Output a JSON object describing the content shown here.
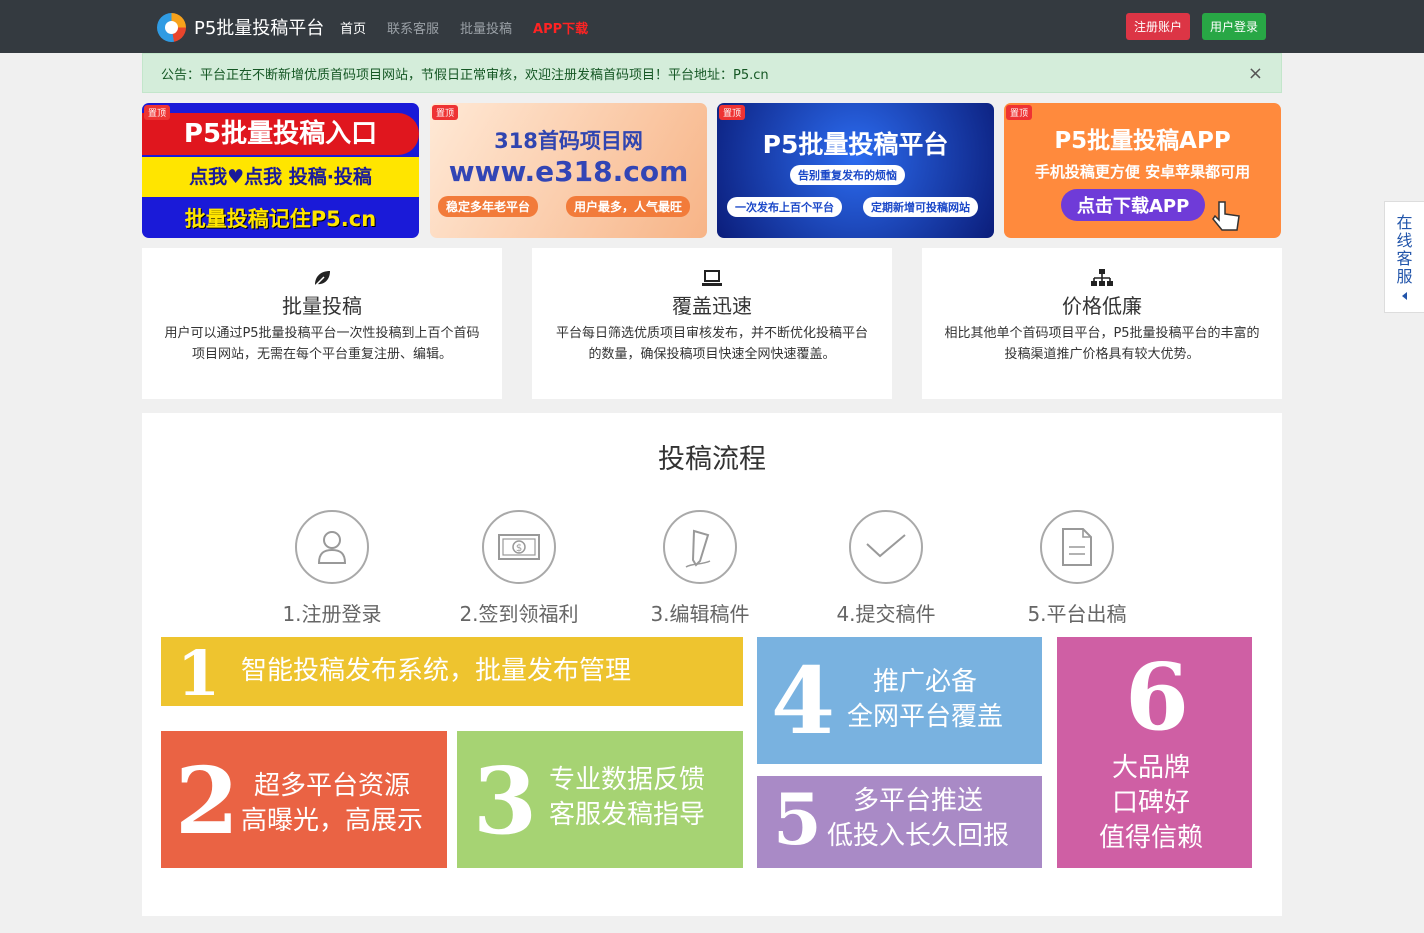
{
  "header": {
    "brand": "P5批量投稿平台",
    "nav": [
      "首页",
      "联系客服",
      "批量投稿",
      "APP下载"
    ],
    "register": "注册账户",
    "login": "用户登录"
  },
  "notice": {
    "text": "公告：平台正在不断新增优质首码项目网站，节假日正常审核，欢迎注册发稿首码项目！平台地址：P5.cn",
    "close": "×"
  },
  "banners": [
    {
      "tag": "置顶",
      "line1": "P5批量投稿入口",
      "line2": "点我♥点我  投稿·投稿",
      "line3": "批量投稿记住P5.cn"
    },
    {
      "tag": "置顶",
      "line1": "318首码项目网",
      "line2": "www.e318.com",
      "pill1": "稳定多年老平台",
      "pill2": "用户最多，人气最旺"
    },
    {
      "tag": "置顶",
      "line1": "P5批量投稿平台",
      "pill1": "告别重复发布的烦恼",
      "pill2": "一次发布上百个平台",
      "pill3": "定期新增可投稿网站"
    },
    {
      "tag": "置顶",
      "line1": "P5批量投稿APP",
      "line2": "手机投稿更方便  安卓苹果都可用",
      "pill1": "点击下载APP"
    }
  ],
  "features": [
    {
      "icon": "leaf-icon",
      "title": "批量投稿",
      "desc": "用户可以通过P5批量投稿平台一次性投稿到上百个首码项目网站，无需在每个平台重复注册、编辑。"
    },
    {
      "icon": "laptop-icon",
      "title": "覆盖迅速",
      "desc": "平台每日筛选优质项目审核发布，并不断优化投稿平台的数量，确保投稿项目快速全网快速覆盖。"
    },
    {
      "icon": "sitemap-icon",
      "title": "价格低廉",
      "desc": "相比其他单个首码项目平台，P5批量投稿平台的丰富的投稿渠道推广价格具有较大优势。"
    }
  ],
  "process": {
    "title": "投稿流程",
    "steps": [
      {
        "icon": "user-icon",
        "label": "1.注册登录"
      },
      {
        "icon": "money-icon",
        "label": "2.签到领福利"
      },
      {
        "icon": "pencil-icon",
        "label": "3.编辑稿件"
      },
      {
        "icon": "check-icon",
        "label": "4.提交稿件"
      },
      {
        "icon": "document-icon",
        "label": "5.平台出稿"
      }
    ],
    "tiles": [
      {
        "num": "1",
        "text": "智能投稿发布系统，批量发布管理",
        "color": "#eec42f"
      },
      {
        "num": "2",
        "text": "超多平台资源\n高曝光，高展示",
        "color": "#ea6344"
      },
      {
        "num": "3",
        "text": "专业数据反馈\n客服发稿指导",
        "color": "#a6d373"
      },
      {
        "num": "4",
        "text": "推广必备\n全网平台覆盖",
        "color": "#79b2e0"
      },
      {
        "num": "5",
        "text": "多平台推送\n低投入长久回报",
        "color": "#a98ac6"
      },
      {
        "num": "6",
        "text": "大品牌\n口碑好\n值得信赖",
        "color": "#cf5fa4"
      }
    ]
  },
  "sidebar": {
    "label": "在线客服"
  }
}
